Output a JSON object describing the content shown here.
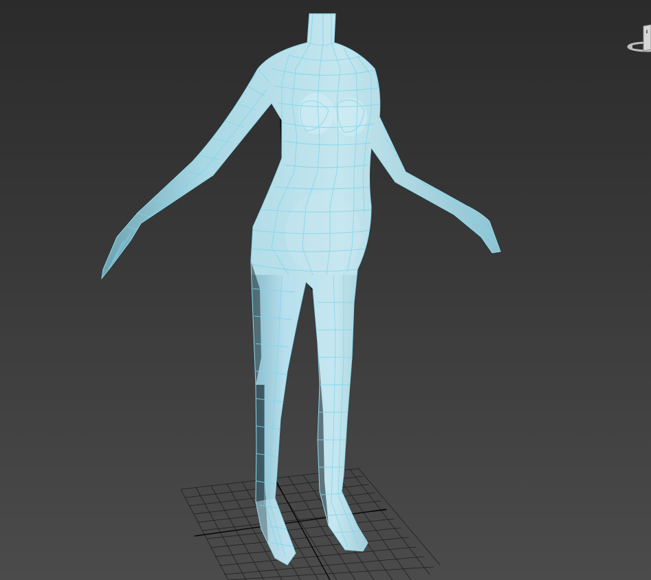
{
  "viewport": {
    "background_top": "#2a2a2a",
    "background_bottom": "#4a4a4a",
    "grid_color": "#1a1a1a",
    "grid_axis_color": "#000000",
    "mesh_fill": "#a9d6e3",
    "mesh_highlight": "#d4eef5",
    "mesh_shadow": "#4c7f8f",
    "wire_color": "#7fd6ec"
  },
  "viewcube": {
    "icon": "viewcube-icon",
    "face_color": "#cfcfcf",
    "ring_color": "#bfbfbf"
  },
  "model": {
    "icon": "body-mesh-icon"
  }
}
